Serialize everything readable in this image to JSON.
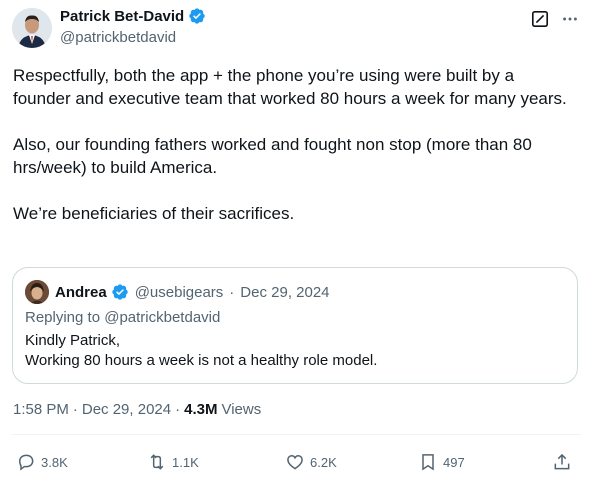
{
  "author": {
    "name": "Patrick Bet-David",
    "handle": "@patrickbetdavid"
  },
  "tweet": {
    "paragraphs": [
      "Respectfully, both the app + the phone you’re using were built by a founder and executive team that worked 80 hours a week for many years.",
      "Also, our founding fathers worked and fought non stop (more than 80 hrs/week) to build America.",
      "We’re beneficiaries of their sacrifices."
    ]
  },
  "quote": {
    "name": "Andrea",
    "handle": "@usebigears",
    "separator": "·",
    "date": "Dec 29, 2024",
    "replying_to": "Replying to @patrickbetdavid",
    "lines": [
      "Kindly Patrick,",
      "Working 80 hours a week is not a healthy role model."
    ]
  },
  "meta": {
    "time": "1:58 PM",
    "separator": "·",
    "date": "Dec 29, 2024",
    "views_count": "4.3M",
    "views_label": "Views"
  },
  "actions": {
    "replies": "3.8K",
    "reposts": "1.1K",
    "likes": "6.2K",
    "bookmarks": "497"
  },
  "colors": {
    "text": "#0f1419",
    "secondary": "#536471",
    "verified": "#1d9bf0",
    "border": "#cfd9de"
  },
  "icons": [
    "verified-icon",
    "grok-icon",
    "more-icon",
    "reply-icon",
    "repost-icon",
    "like-icon",
    "bookmark-icon",
    "share-icon"
  ]
}
